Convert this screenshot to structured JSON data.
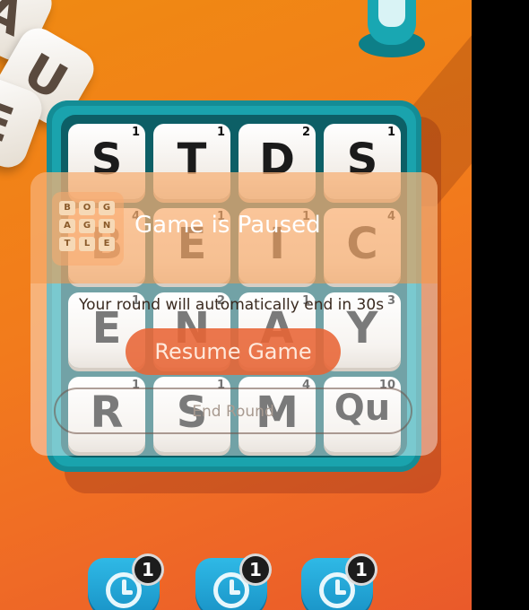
{
  "pause": {
    "title": "Game is Paused",
    "message": "Your round will automatically end in 30s",
    "resume_label": "Resume Game",
    "end_label": "End Round"
  },
  "logo": {
    "letters": [
      "B",
      "O",
      "G",
      "A",
      "G",
      "N",
      "T",
      "L",
      "E"
    ]
  },
  "board": {
    "tiles": [
      {
        "letter": "S",
        "points": "1"
      },
      {
        "letter": "T",
        "points": "1"
      },
      {
        "letter": "D",
        "points": "2"
      },
      {
        "letter": "S",
        "points": "1"
      },
      {
        "letter": "B",
        "points": "4"
      },
      {
        "letter": "E",
        "points": "1"
      },
      {
        "letter": "I",
        "points": "1"
      },
      {
        "letter": "C",
        "points": "4"
      },
      {
        "letter": "E",
        "points": "1"
      },
      {
        "letter": "N",
        "points": "2"
      },
      {
        "letter": "A",
        "points": "1"
      },
      {
        "letter": "Y",
        "points": "3"
      },
      {
        "letter": "R",
        "points": "1"
      },
      {
        "letter": "S",
        "points": "1"
      },
      {
        "letter": "M",
        "points": "4"
      },
      {
        "letter": "Qu",
        "points": "10"
      }
    ]
  },
  "powerups": [
    {
      "icon": "clock-icon",
      "count": "1"
    },
    {
      "icon": "clock-icon",
      "count": "1"
    },
    {
      "icon": "clock-icon",
      "count": "1"
    }
  ],
  "decor": {
    "dice": [
      "A",
      "U",
      "E"
    ]
  },
  "colors": {
    "background": "#f27b1c",
    "board": "#1aa3ad",
    "resume_button": "#e86434",
    "powerup": "#1790c4"
  }
}
